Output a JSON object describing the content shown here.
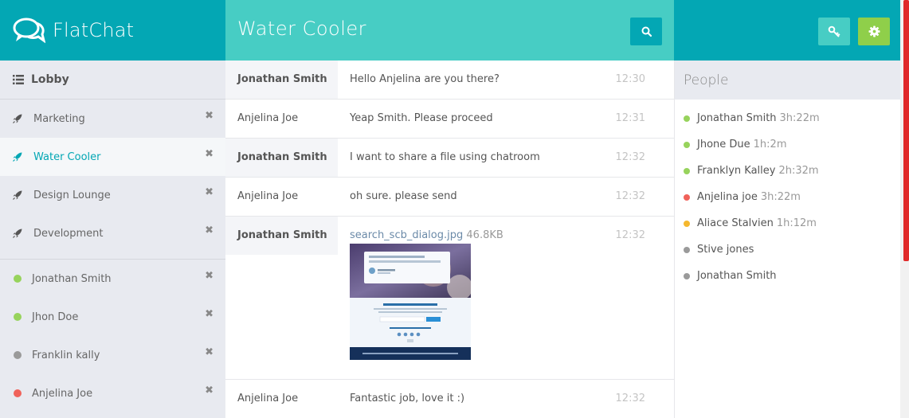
{
  "app": {
    "brand": "FlatChat",
    "room_title": "Water Cooler"
  },
  "icons": {
    "logo": "chat-bubbles-icon",
    "search": "search-icon",
    "key": "key-icon",
    "settings": "gear-icon",
    "lobby": "list-icon",
    "room": "rocket-icon",
    "remove": "close-icon"
  },
  "colors": {
    "brand": "#03a7b4",
    "room_header": "#47cdc4",
    "settings_button": "#8fcf4a",
    "online": "#97d35c",
    "busy": "#f0625a",
    "away": "#f5b82e",
    "offline": "#9a9a9a"
  },
  "sidebar": {
    "lobby_label": "Lobby",
    "rooms": [
      {
        "label": "Marketing",
        "active": false
      },
      {
        "label": "Water Cooler",
        "active": true
      },
      {
        "label": "Design Lounge",
        "active": false
      },
      {
        "label": "Development",
        "active": false
      }
    ],
    "contacts": [
      {
        "label": "Jonathan Smith",
        "status": "online"
      },
      {
        "label": "Jhon Doe",
        "status": "online"
      },
      {
        "label": "Franklin kally",
        "status": "offline"
      },
      {
        "label": "Anjelina Joe",
        "status": "busy"
      }
    ]
  },
  "messages": [
    {
      "sender": "Jonathan Smith",
      "text": "Hello Anjelina are you there?",
      "time": "12:30",
      "shaded": true
    },
    {
      "sender": "Anjelina Joe",
      "text": "Yeap Smith. Please proceed",
      "time": "12:31",
      "shaded": false
    },
    {
      "sender": "Jonathan Smith",
      "text": "I want to share a file using chatroom",
      "time": "12:32",
      "shaded": true
    },
    {
      "sender": "Anjelina Joe",
      "text": "oh sure. please send",
      "time": "12:32",
      "shaded": false
    },
    {
      "sender": "Jonathan Smith",
      "file_name": "search_scb_dialog.jpg",
      "file_size": "46.8KB",
      "time": "12:32",
      "shaded": true
    },
    {
      "sender": "Anjelina Joe",
      "text": "Fantastic job, love it :)",
      "time": "12:32",
      "shaded": false
    }
  ],
  "people": {
    "title": "People",
    "list": [
      {
        "name": "Jonathan Smith",
        "time": "3h:22m",
        "status": "online"
      },
      {
        "name": "Jhone Due",
        "time": "1h:2m",
        "status": "online"
      },
      {
        "name": "Franklyn Kalley",
        "time": "2h:32m",
        "status": "online"
      },
      {
        "name": "Anjelina joe",
        "time": "3h:22m",
        "status": "busy"
      },
      {
        "name": "Aliace Stalvien",
        "time": "1h:12m",
        "status": "away"
      },
      {
        "name": "Stive jones",
        "time": "",
        "status": "offline"
      },
      {
        "name": "Jonathan Smith",
        "time": "",
        "status": "offline"
      }
    ]
  }
}
